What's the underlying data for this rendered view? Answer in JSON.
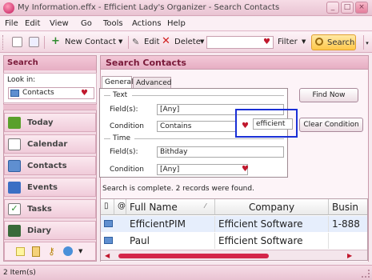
{
  "window": {
    "title": "My Information.effx - Efficient Lady's Organizer - Search Contacts"
  },
  "menu": [
    "File",
    "Edit",
    "View",
    "Go",
    "Tools",
    "Actions",
    "Help"
  ],
  "toolbar": {
    "new_contact": "New Contact",
    "edit": "Edit",
    "delete": "Delete",
    "filter": "Filter",
    "search": "Search"
  },
  "sidebar": {
    "header": "Search",
    "look_in_label": "Look in:",
    "look_in_value": "Contacts",
    "items": [
      "Today",
      "Calendar",
      "Contacts",
      "Events",
      "Tasks",
      "Diary"
    ]
  },
  "main": {
    "title": "Search Contacts",
    "tabs": [
      "General",
      "Advanced"
    ],
    "text_section": "Text",
    "time_section": "Time",
    "fields_label": "Field(s):",
    "fields_value": "[Any]",
    "condition_label": "Condition",
    "condition_value": "Contains",
    "search_text": "efficient",
    "time_fields_value": "Bithday",
    "time_condition_value": "[Any]",
    "find_now": "Find Now",
    "clear_condition": "Clear Condition",
    "status": "Search is complete. 2 records were found."
  },
  "grid": {
    "columns": [
      "Full Name",
      "Company",
      "Busin"
    ],
    "rows": [
      {
        "full_name": "EfficientPIM",
        "company": "Efficient Software",
        "business": "1-888"
      },
      {
        "full_name": "Paul",
        "company": "Efficient Software",
        "business": ""
      }
    ]
  },
  "statusbar": {
    "text": "2 Item(s)"
  },
  "colors": {
    "accent": "#c2185b",
    "highlight_box": "#1a2fd6",
    "heart": "#c0182d"
  }
}
